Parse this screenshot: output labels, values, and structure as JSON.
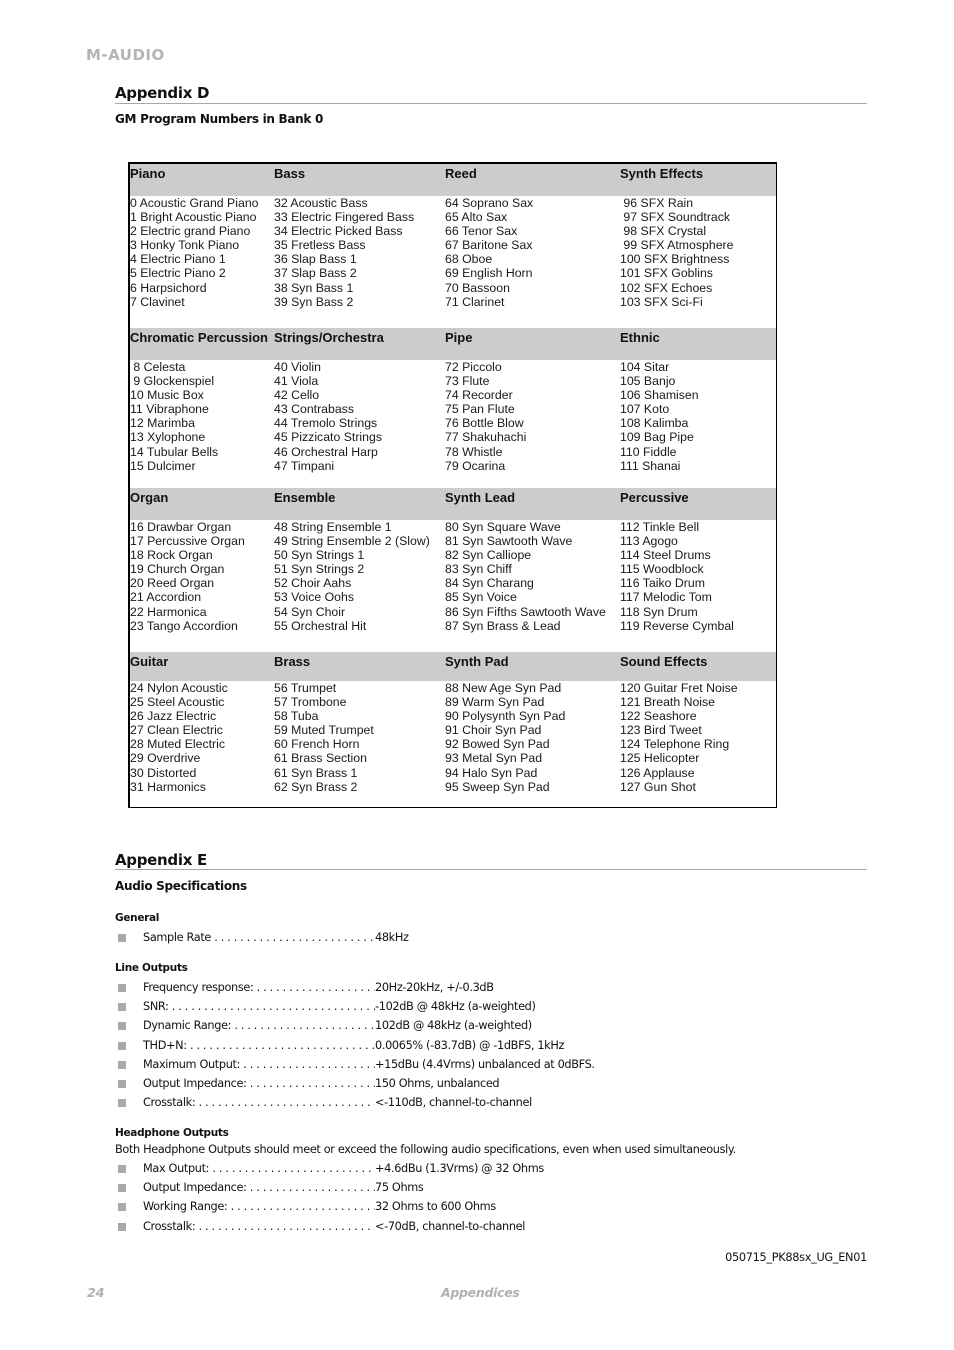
{
  "header": {
    "brand": "M-AUDIO"
  },
  "appendix_d": {
    "title": "Appendix D",
    "subtitle": "GM Program Numbers in Bank 0",
    "sections": [
      {
        "headers": [
          "Piano",
          "Bass",
          "Reed",
          "Synth Effects"
        ],
        "columns": [
          [
            "0 Acoustic Grand Piano",
            "1 Bright Acoustic Piano",
            "2 Electric grand Piano",
            "3 Honky Tonk Piano",
            "4 Electric Piano 1",
            "5 Electric Piano 2",
            "6 Harpsichord",
            "7 Clavinet"
          ],
          [
            "32 Acoustic Bass",
            "33 Electric Fingered Bass",
            "34 Electric Picked Bass",
            "35 Fretless Bass",
            "36 Slap Bass 1",
            "37 Slap Bass 2",
            "38 Syn Bass 1",
            "39 Syn Bass 2"
          ],
          [
            "64 Soprano Sax",
            "65 Alto Sax",
            "66 Tenor Sax",
            "67 Baritone Sax",
            "68 Oboe",
            "69 English Horn",
            "70 Bassoon",
            "71 Clarinet"
          ],
          [
            " 96 SFX Rain",
            " 97 SFX Soundtrack",
            " 98 SFX Crystal",
            " 99 SFX Atmosphere",
            "100 SFX Brightness",
            "101 SFX Goblins",
            "102 SFX Echoes",
            "103 SFX Sci-Fi"
          ]
        ]
      },
      {
        "headers": [
          "Chromatic Percussion",
          "Strings/Orchestra",
          "Pipe",
          "Ethnic"
        ],
        "columns": [
          [
            " 8 Celesta",
            " 9 Glockenspiel",
            "10 Music Box",
            "11 Vibraphone",
            "12 Marimba",
            "13 Xylophone",
            "14 Tubular Bells",
            "15 Dulcimer"
          ],
          [
            "40 Violin",
            "41 Viola",
            "42 Cello",
            "43 Contrabass",
            "44 Tremolo Strings",
            "45 Pizzicato Strings",
            "46 Orchestral Harp",
            "47 Timpani"
          ],
          [
            "72 Piccolo",
            "73 Flute",
            "74 Recorder",
            "75 Pan Flute",
            "76 Bottle Blow",
            "77 Shakuhachi",
            "78 Whistle",
            "79 Ocarina"
          ],
          [
            "104 Sitar",
            "105 Banjo",
            "106 Shamisen",
            "107 Koto",
            "108 Kalimba",
            "109 Bag Pipe",
            "110 Fiddle",
            "111 Shanai"
          ]
        ]
      },
      {
        "headers": [
          "Organ",
          "Ensemble",
          "Synth Lead",
          "Percussive"
        ],
        "columns": [
          [
            "16 Drawbar Organ",
            "17 Percussive Organ",
            "18 Rock Organ",
            "19 Church Organ",
            "20 Reed Organ",
            "21 Accordion",
            "22 Harmonica",
            "23 Tango Accordion"
          ],
          [
            "48 String Ensemble 1",
            "49 String Ensemble 2 (Slow)",
            "50 Syn Strings 1",
            "51 Syn Strings 2",
            "52 Choir Aahs",
            "53 Voice Oohs",
            "54 Syn Choir",
            "55 Orchestral Hit"
          ],
          [
            "80 Syn Square Wave",
            "81 Syn Sawtooth Wave",
            "82 Syn Calliope",
            "83 Syn Chiff",
            "84 Syn Charang",
            "85 Syn Voice",
            "86 Syn Fifths Sawtooth Wave",
            "87 Syn Brass & Lead"
          ],
          [
            "112 Tinkle Bell",
            "113 Agogo",
            "114 Steel Drums",
            "115 Woodblock",
            "116 Taiko Drum",
            "117 Melodic Tom",
            "118 Syn Drum",
            "119 Reverse Cymbal"
          ]
        ]
      },
      {
        "headers": [
          "Guitar",
          "Brass",
          "Synth Pad",
          "Sound Effects"
        ],
        "columns": [
          [
            "24 Nylon Acoustic",
            "25 Steel Acoustic",
            "26 Jazz Electric",
            "27 Clean Electric",
            "28 Muted Electric",
            "29 Overdrive",
            "30 Distorted",
            "31 Harmonics"
          ],
          [
            "56 Trumpet",
            "57 Trombone",
            "58 Tuba",
            "59 Muted Trumpet",
            "60 French Horn",
            "61 Brass Section",
            "61 Syn Brass 1",
            "62 Syn Brass 2"
          ],
          [
            "88 New Age Syn Pad",
            "89 Warm Syn Pad",
            "90 Polysynth Syn Pad",
            "91 Choir Syn Pad",
            "92 Bowed Syn Pad",
            "93 Metal Syn Pad",
            "94 Halo Syn Pad",
            "95 Sweep Syn Pad"
          ],
          [
            "120 Guitar Fret Noise",
            "121 Breath Noise",
            "122 Seashore",
            "123 Bird Tweet",
            "124 Telephone Ring",
            "125 Helicopter",
            "126 Applause",
            "127 Gun Shot"
          ]
        ]
      }
    ]
  },
  "appendix_e": {
    "title": "Appendix E",
    "subtitle": "Audio Specifications",
    "general": {
      "heading": "General",
      "items": [
        {
          "label": "Sample Rate",
          "value": "48kHz"
        }
      ]
    },
    "line_outputs": {
      "heading": "Line Outputs",
      "items": [
        {
          "label": "Frequency response:",
          "value": "20Hz-20kHz, +/-0.3dB"
        },
        {
          "label": "SNR:",
          "value": "-102dB @ 48kHz  (a-weighted)"
        },
        {
          "label": "Dynamic Range:",
          "value": "102dB @ 48kHz  (a-weighted)"
        },
        {
          "label": "THD+N:",
          "value": "0.0065% (-83.7dB) @ -1dBFS, 1kHz"
        },
        {
          "label": "Maximum Output:",
          "value": "+15dBu (4.4Vrms) unbalanced at 0dBFS."
        },
        {
          "label": "Output Impedance:",
          "value": "150 Ohms, unbalanced"
        },
        {
          "label": "Crosstalk:",
          "value": "<-110dB, channel-to-channel"
        }
      ]
    },
    "headphone_outputs": {
      "heading": "Headphone Outputs",
      "note": "Both Headphone Outputs should meet or exceed the following audio specifications, even when used simultaneously.",
      "items": [
        {
          "label": "Max Output:",
          "value": "+4.6dBu (1.3Vrms) @ 32 Ohms"
        },
        {
          "label": "Output Impedance:",
          "value": "75 Ohms"
        },
        {
          "label": "Working Range:",
          "value": "32 Ohms to 600 Ohms"
        },
        {
          "label": "Crosstalk:",
          "value": "<-70dB, channel-to-channel"
        }
      ]
    }
  },
  "footer": {
    "doc_id": "050715_PK88sx_UG_EN01",
    "page_number": "24",
    "section_title": "Appendices"
  }
}
